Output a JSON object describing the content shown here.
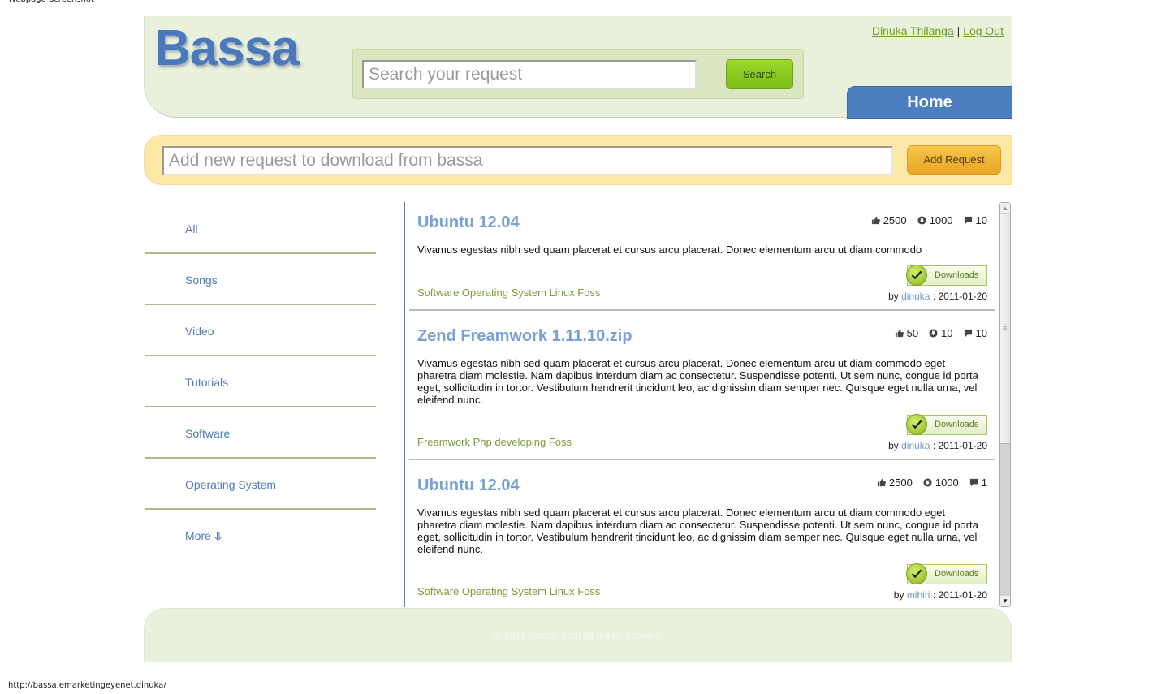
{
  "caption": "Webpage Screenshot",
  "status_url": "http://bassa.emarketingeyenet.dinuka/",
  "header": {
    "logo": "Bassa",
    "search_placeholder": "Search your request",
    "search_button": "Search",
    "user_name": "Dinuka Thilanga",
    "separator": "|",
    "logout": "Log Out",
    "home_tab": "Home"
  },
  "add_request": {
    "placeholder": "Add new request to download from bassa",
    "button": "Add Request"
  },
  "sidebar": {
    "items": [
      {
        "label": "All"
      },
      {
        "label": "Songs"
      },
      {
        "label": "Video"
      },
      {
        "label": "Tutorials"
      },
      {
        "label": "Software"
      },
      {
        "label": "Operating System"
      },
      {
        "label": "More ⥥"
      }
    ]
  },
  "requests": [
    {
      "title": "Ubuntu 12.04",
      "likes": "2500",
      "downloads": "1000",
      "comments": "10",
      "description": "Vivamus egestas nibh sed quam placerat et cursus arcu placerat. Donec elementum arcu ut diam commodo",
      "tags": "Software Operating System Linux Foss",
      "button": "Downloads",
      "by": "by",
      "user": "dinuka",
      "date": ": 2011-01-20"
    },
    {
      "title": "Zend Freamwork 1.11.10.zip",
      "likes": "50",
      "downloads": "10",
      "comments": "10",
      "description": "Vivamus egestas nibh sed quam placerat et cursus arcu placerat. Donec elementum arcu ut diam commodo eget pharetra diam molestie. Nam dapibus interdum diam ac consectetur. Suspendisse potenti. Ut sem nunc, congue id porta eget, sollicitudin in tortor. Vestibulum hendrerit tincidunt leo, ac dignissim diam semper nec. Quisque eget nulla urna, vel eleifend nunc.",
      "tags": "Freamwork Php developing Foss",
      "button": "Downloads",
      "by": "by",
      "user": "dinuka",
      "date": ": 2011-01-20"
    },
    {
      "title": "Ubuntu 12.04",
      "likes": "2500",
      "downloads": "1000",
      "comments": "1",
      "description": "Vivamus egestas nibh sed quam placerat et cursus arcu placerat. Donec elementum arcu ut diam commodo eget pharetra diam molestie. Nam dapibus interdum diam ac consectetur. Suspendisse potenti. Ut sem nunc, congue id porta eget, sollicitudin in tortor. Vestibulum hendrerit tincidunt leo, ac dignissim diam semper nec. Quisque eget nulla urna, vel eleifend nunc.",
      "tags": "Software Operating System Linux Foss",
      "button": "Downloads",
      "by": "by",
      "user": "mihiri",
      "date": ": 2011-01-20"
    }
  ],
  "footer": {
    "copyright": "© 2011 Bassa client All rights reserved"
  }
}
